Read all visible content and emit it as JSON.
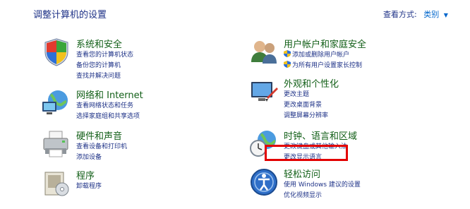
{
  "header": {
    "title": "调整计算机的设置",
    "view_by_label": "查看方式:",
    "view_by_value": "类别"
  },
  "categories": [
    {
      "title": "系统和安全",
      "links": [
        "查看您的计算机状态",
        "备份您的计算机",
        "查找并解决问题"
      ],
      "icon": "shield-icon"
    },
    {
      "title": "网络和 Internet",
      "links": [
        "查看网络状态和任务",
        "选择家庭组和共享选项"
      ],
      "icon": "network-icon"
    },
    {
      "title": "硬件和声音",
      "links": [
        "查看设备和打印机",
        "添加设备"
      ],
      "icon": "printer-icon"
    },
    {
      "title": "程序",
      "links": [
        "卸载程序"
      ],
      "icon": "programs-icon"
    },
    {
      "title": "用户帐户和家庭安全",
      "links": [
        "添加或删除用户帐户",
        "为所有用户设置家长控制"
      ],
      "icon": "users-icon"
    },
    {
      "title": "外观和个性化",
      "links": [
        "更改主题",
        "更改桌面背景",
        "调整屏幕分辨率"
      ],
      "icon": "appearance-icon"
    },
    {
      "title": "时钟、语言和区域",
      "links": [
        "更改键盘或其他输入法",
        "更改显示语言"
      ],
      "icon": "clock-globe-icon"
    },
    {
      "title": "轻松访问",
      "links": [
        "使用 Windows 建议的设置",
        "优化视频显示"
      ],
      "icon": "ease-of-access-icon"
    }
  ],
  "colors": {
    "link": "#1e3287",
    "title": "#125f17",
    "highlight": "#e30000"
  }
}
